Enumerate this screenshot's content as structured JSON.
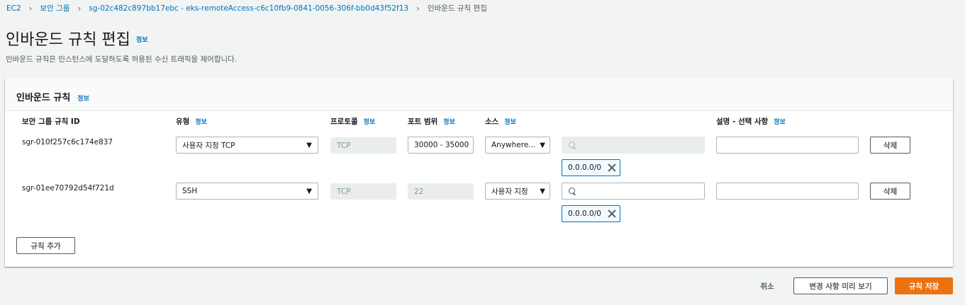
{
  "breadcrumb": {
    "items": [
      "EC2",
      "보안 그룹",
      "sg-02c482c897bb17ebc - eks-remoteAccess-c6c10fb9-0841-0056-306f-bb0d43f52f13"
    ],
    "current": "인바운드 규칙 편집"
  },
  "page": {
    "title": "인바운드 규칙 편집",
    "info": "정보",
    "description": "인바운드 규칙은 인스턴스에 도달하도록 허용된 수신 트래픽을 제어합니다."
  },
  "panel": {
    "title": "인바운드 규칙",
    "info": "정보",
    "columns": {
      "rule_id": "보안 그룹 규칙 ID",
      "type": "유형",
      "protocol": "프로토콜",
      "port_range": "포트 범위",
      "source": "소스",
      "description": "설명 - 선택 사항",
      "info": "정보"
    },
    "rows": [
      {
        "rule_id": "sgr-010f257c6c174e837",
        "type": "사용자 지정 TCP",
        "protocol": "TCP",
        "port_range": "30000 - 35000",
        "source": "Anywhere...",
        "search_value": "",
        "cidr": "0.0.0.0/0",
        "description": "",
        "delete_label": "삭제"
      },
      {
        "rule_id": "sgr-01ee70792d54f721d",
        "type": "SSH",
        "protocol": "TCP",
        "port_range": "22",
        "source": "사용자 지정",
        "search_value": "",
        "cidr": "0.0.0.0/0",
        "description": "",
        "delete_label": "삭제"
      }
    ],
    "add_rule_label": "규칙 추가"
  },
  "footer": {
    "cancel_label": "취소",
    "preview_label": "변경 사항 미리 보기",
    "save_label": "규칙 저장"
  },
  "colors": {
    "primary": "#ec7211",
    "link": "#0073bb",
    "background": "#f2f3f3"
  }
}
